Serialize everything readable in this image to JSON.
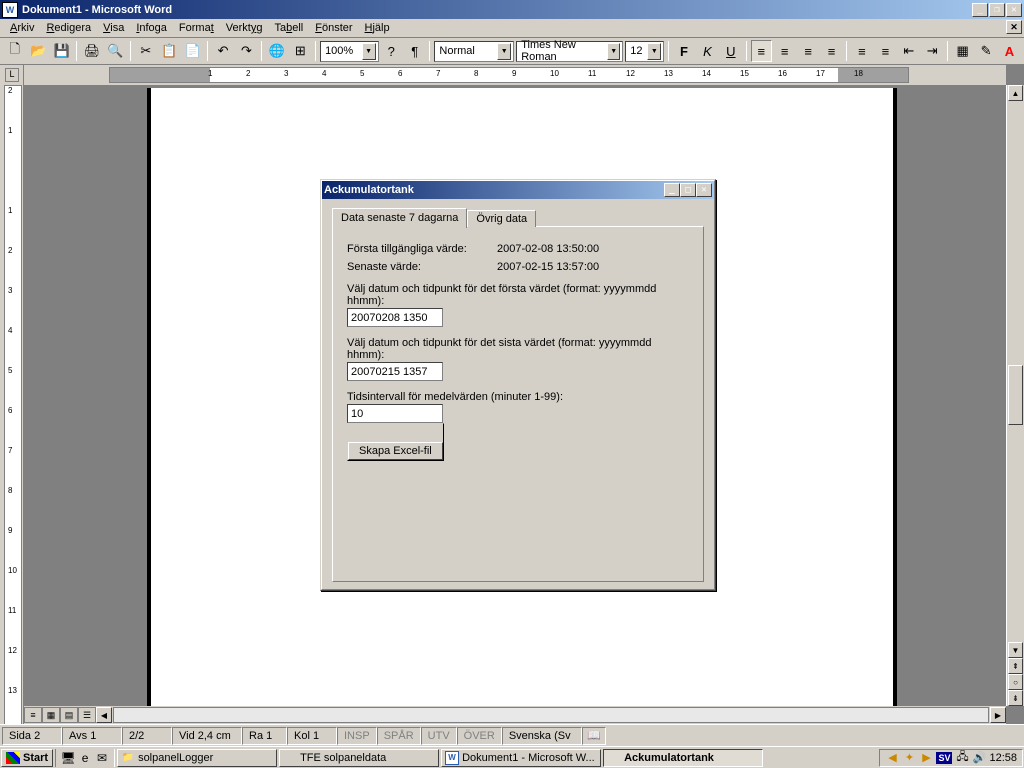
{
  "app": {
    "title": "Dokument1 - Microsoft Word",
    "menus": [
      "Arkiv",
      "Redigera",
      "Visa",
      "Infoga",
      "Format",
      "Verktyg",
      "Tabell",
      "Fönster",
      "Hjälp"
    ]
  },
  "toolbar": {
    "zoom": "100%",
    "style": "Normal",
    "font": "Times New Roman",
    "size": "12"
  },
  "statusbar": {
    "page": "Sida 2",
    "section": "Avs 1",
    "pages": "2/2",
    "at": "Vid 2,4 cm",
    "line": "Ra 1",
    "col": "Kol 1",
    "insp": "INSP",
    "spar": "SPÅR",
    "utv": "UTV",
    "over": "ÖVER",
    "lang": "Svenska (Sv"
  },
  "taskbar": {
    "start": "Start",
    "tasks": [
      {
        "label": "solpanelLogger",
        "icon": "📁"
      },
      {
        "label": "TFE solpaneldata",
        "icon": ""
      },
      {
        "label": "Dokument1 - Microsoft W...",
        "icon": "W"
      },
      {
        "label": "Ackumulatortank",
        "icon": ""
      }
    ],
    "lang": "SV",
    "clock": "12:58"
  },
  "dialog": {
    "title": "Ackumulatortank",
    "tabs": [
      "Data senaste 7 dagarna",
      "Övrig data"
    ],
    "first_available_label": "Första tillgängliga värde:",
    "first_available_value": "2007-02-08 13:50:00",
    "latest_label": "Senaste värde:",
    "latest_value": "2007-02-15 13:57:00",
    "pick_first_label": "Välj datum och tidpunkt för det första värdet (format: yyyymmdd hhmm):",
    "pick_first_value": "20070208 1350",
    "pick_last_label": "Välj datum och tidpunkt för det sista värdet (format: yyyymmdd hhmm):",
    "pick_last_value": "20070215 1357",
    "interval_label": "Tidsintervall för medelvärden (minuter 1-99):",
    "interval_value": "10",
    "create_button": "Skapa Excel-fil"
  },
  "ruler": {
    "h": [
      "1",
      "2",
      "3",
      "4",
      "5",
      "6",
      "7",
      "8",
      "9",
      "10",
      "11",
      "12",
      "13",
      "14",
      "15",
      "16",
      "17",
      "18"
    ],
    "v": [
      "2",
      "1",
      "",
      "1",
      "2",
      "3",
      "4",
      "5",
      "6",
      "7",
      "8",
      "9",
      "10",
      "11",
      "12",
      "13"
    ]
  }
}
